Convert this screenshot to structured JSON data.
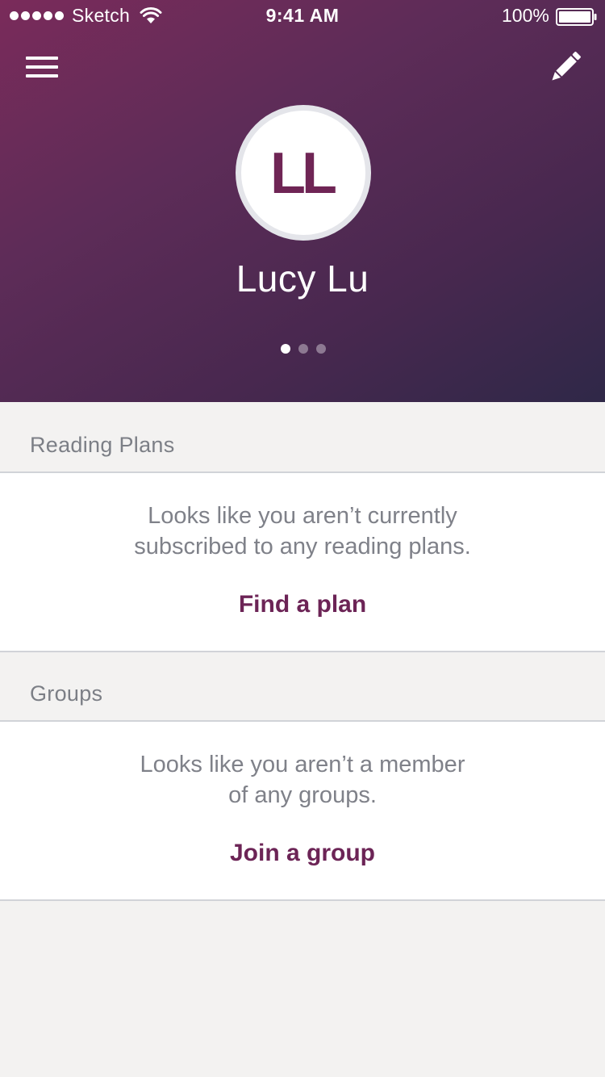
{
  "status_bar": {
    "carrier": "Sketch",
    "time": "9:41 AM",
    "battery": "100%"
  },
  "header": {
    "icons": {
      "menu": "hamburger-menu-icon",
      "edit": "pencil-icon"
    },
    "avatar_initials": "LL",
    "user_name": "Lucy Lu",
    "page_indicator": {
      "count": 3,
      "active": 0
    }
  },
  "reading_plans": {
    "title": "Reading Plans",
    "empty_line1": "Looks like you aren’t currently",
    "empty_line2": "subscribed to any reading plans.",
    "action": "Find a plan"
  },
  "groups": {
    "title": "Groups",
    "empty_line1": "Looks like you aren’t a member",
    "empty_line2": "of any groups.",
    "action": "Join a group"
  },
  "colors": {
    "header_gradient_start": "#7a2b5a",
    "header_gradient_end": "#2f2848",
    "accent": "#6c2456",
    "background": "#f3f2f1"
  }
}
